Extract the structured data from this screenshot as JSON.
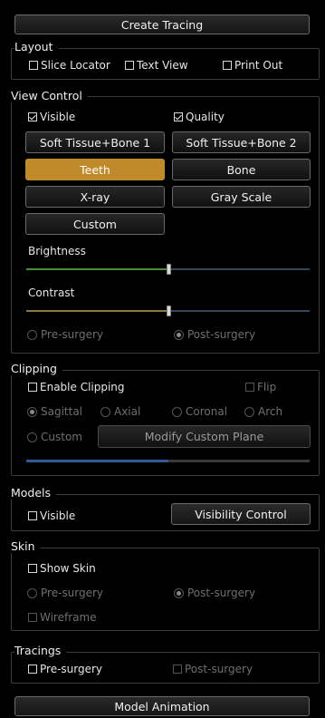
{
  "create_tracing": "Create Tracing",
  "layout": {
    "title": "Layout",
    "slice_locator": "Slice Locator",
    "text_view": "Text View",
    "print_out": "Print Out"
  },
  "view_control": {
    "title": "View Control",
    "visible": "Visible",
    "quality": "Quality",
    "soft_tissue_bone_1": "Soft Tissue+Bone 1",
    "soft_tissue_bone_2": "Soft Tissue+Bone 2",
    "teeth": "Teeth",
    "bone": "Bone",
    "xray": "X-ray",
    "gray_scale": "Gray Scale",
    "custom": "Custom",
    "brightness": "Brightness",
    "contrast": "Contrast",
    "brightness_value": 0.5,
    "contrast_value": 0.5,
    "pre_surgery": "Pre-surgery",
    "post_surgery": "Post-surgery"
  },
  "clipping": {
    "title": "Clipping",
    "enable_clipping": "Enable Clipping",
    "flip": "Flip",
    "sagittal": "Sagittal",
    "axial": "Axial",
    "coronal": "Coronal",
    "arch": "Arch",
    "custom": "Custom",
    "modify_custom_plane": "Modify Custom Plane",
    "progress_value": 0.5
  },
  "models": {
    "title": "Models",
    "visible": "Visible",
    "visibility_control": "Visibility Control"
  },
  "skin": {
    "title": "Skin",
    "show_skin": "Show Skin",
    "pre_surgery": "Pre-surgery",
    "post_surgery": "Post-surgery",
    "wireframe": "Wireframe"
  },
  "tracings": {
    "title": "Tracings",
    "pre_surgery": "Pre-surgery",
    "post_surgery": "Post-surgery"
  },
  "model_animation": "Model Animation",
  "colors": {
    "accent": "#c08a2a",
    "brightness_fill": "#4e8a3a",
    "contrast_fill": "#8a7a3a",
    "progress_fill": "#2e5a96"
  }
}
